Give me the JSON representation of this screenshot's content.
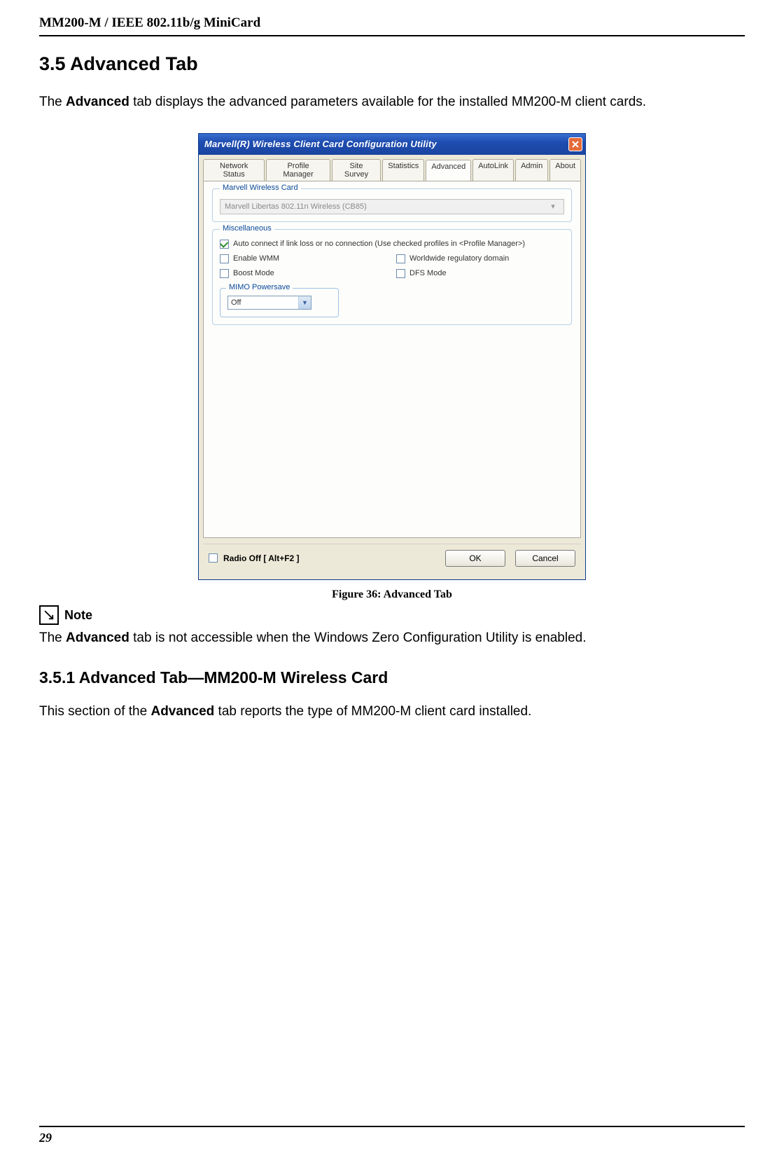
{
  "header": {
    "title": "MM200-M / IEEE 802.11b/g MiniCard"
  },
  "section": {
    "heading": "3.5 Advanced Tab",
    "intro_pre": "The ",
    "intro_bold": "Advanced",
    "intro_post": " tab displays the advanced parameters available for the installed MM200-M client cards."
  },
  "dialog": {
    "title": "Marvell(R) Wireless Client Card Configuration Utility",
    "tabs": [
      "Network Status",
      "Profile Manager",
      "Site Survey",
      "Statistics",
      "Advanced",
      "AutoLink",
      "Admin",
      "About"
    ],
    "active_tab_index": 4,
    "card_group_legend": "Marvell Wireless Card",
    "card_value": "Marvell Libertas 802.11n Wireless (CB85)",
    "misc_legend": "Miscellaneous",
    "checks": {
      "auto_connect": {
        "label": "Auto connect if link loss or no connection (Use checked profiles in <Profile Manager>)",
        "checked": true
      },
      "enable_wmm": {
        "label": "Enable WMM",
        "checked": false
      },
      "wwrd": {
        "label": "Worldwide regulatory domain",
        "checked": false
      },
      "boost": {
        "label": "Boost Mode",
        "checked": false
      },
      "dfs": {
        "label": "DFS Mode",
        "checked": false
      }
    },
    "mimo": {
      "legend": "MIMO Powersave",
      "value": "Off"
    },
    "radio_off": {
      "label": "Radio Off  [ Alt+F2 ]",
      "checked": false
    },
    "buttons": {
      "ok": "OK",
      "cancel": "Cancel"
    }
  },
  "figure_caption": "Figure 36: Advanced Tab",
  "note": {
    "label": "Note",
    "pre": "The ",
    "bold": "Advanced",
    "post": " tab is not accessible when the Windows Zero Configuration Utility is enabled."
  },
  "subsection": {
    "heading": "3.5.1 Advanced Tab—MM200-M Wireless Card",
    "pre": "This section of the ",
    "bold": "Advanced",
    "post": " tab reports the type of MM200-M client card installed."
  },
  "page_number": "29"
}
